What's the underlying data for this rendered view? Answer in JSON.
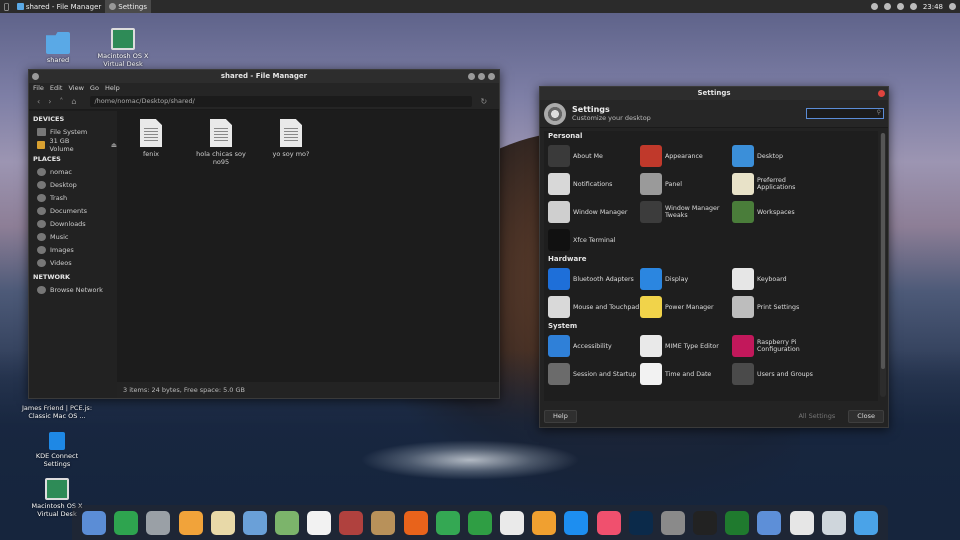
{
  "topbar": {
    "tasks": [
      {
        "label": "shared - File Manager",
        "icon": "folder-icon",
        "active": false
      },
      {
        "label": "Settings",
        "icon": "gear-icon",
        "active": true
      }
    ],
    "clock": "23:48"
  },
  "desktop_icons": [
    {
      "label": "shared",
      "icon": "folder-icon",
      "color": "#5aa9e6"
    },
    {
      "label": "Macintosh OS X Virtual Desk",
      "icon": "app-icon",
      "color": "#2e8b57"
    },
    {
      "label": "James Friend | PCE.js: Classic Mac OS ...",
      "icon": "web-icon",
      "color": "#888888"
    },
    {
      "label": "KDE Connect Settings",
      "icon": "kde-connect-icon",
      "color": "#1e88e5"
    },
    {
      "label": "Macintosh OS X Virtual Desk",
      "icon": "app-icon",
      "color": "#2e8b57"
    }
  ],
  "file_manager": {
    "title": "shared - File Manager",
    "menu": [
      "File",
      "Edit",
      "View",
      "Go",
      "Help"
    ],
    "path": "/home/nomac/Desktop/shared/",
    "devices_header": "DEVICES",
    "devices": [
      "File System",
      "31 GB Volume"
    ],
    "places_header": "PLACES",
    "places": [
      "nomac",
      "Desktop",
      "Trash",
      "Documents",
      "Downloads",
      "Music",
      "Images",
      "Videos"
    ],
    "network_header": "NETWORK",
    "network": [
      "Browse Network"
    ],
    "files": [
      "fenix",
      "hola chicas soy no95",
      "yo soy mo?"
    ],
    "status": "3 items: 24 bytes, Free space: 5.0 GB"
  },
  "settings": {
    "title": "Settings",
    "header_title": "Settings",
    "header_subtitle": "Customize your desktop",
    "sections": [
      {
        "name": "Personal",
        "items": [
          {
            "label": "About Me",
            "icon": "about-me-icon",
            "color": "#3a3a3a"
          },
          {
            "label": "Appearance",
            "icon": "appearance-icon",
            "color": "#c0392b"
          },
          {
            "label": "Desktop",
            "icon": "desktop-icon",
            "color": "#3b8fd9"
          },
          {
            "label": "Notifications",
            "icon": "notifications-icon",
            "color": "#d8d8d8"
          },
          {
            "label": "Panel",
            "icon": "panel-icon",
            "color": "#9a9a9a"
          },
          {
            "label": "Preferred Applications",
            "icon": "preferred-apps-icon",
            "color": "#e8e2c8"
          },
          {
            "label": "Window Manager",
            "icon": "window-manager-icon",
            "color": "#cfcfcf"
          },
          {
            "label": "Window Manager Tweaks",
            "icon": "wm-tweaks-icon",
            "color": "#3c3c3c"
          },
          {
            "label": "Workspaces",
            "icon": "workspaces-icon",
            "color": "#4a7d3a"
          },
          {
            "label": "Xfce Terminal",
            "icon": "terminal-icon",
            "color": "#111111"
          }
        ]
      },
      {
        "name": "Hardware",
        "items": [
          {
            "label": "Bluetooth Adapters",
            "icon": "bluetooth-icon",
            "color": "#1e6fd9"
          },
          {
            "label": "Display",
            "icon": "display-icon",
            "color": "#2b86e0"
          },
          {
            "label": "Keyboard",
            "icon": "keyboard-icon",
            "color": "#e6e6e6"
          },
          {
            "label": "Mouse and Touchpad",
            "icon": "mouse-icon",
            "color": "#d9d9d9"
          },
          {
            "label": "Power Manager",
            "icon": "power-bulb-icon",
            "color": "#f1d34a"
          },
          {
            "label": "Print Settings",
            "icon": "printer-icon",
            "color": "#bdbdbd"
          }
        ]
      },
      {
        "name": "System",
        "items": [
          {
            "label": "Accessibility",
            "icon": "accessibility-icon",
            "color": "#2f80d8"
          },
          {
            "label": "MIME Type Editor",
            "icon": "mime-editor-icon",
            "color": "#e9e9e9"
          },
          {
            "label": "Raspberry Pi Configuration",
            "icon": "raspberry-icon",
            "color": "#c2185b"
          },
          {
            "label": "Session and Startup",
            "icon": "session-icon",
            "color": "#6b6b6b"
          },
          {
            "label": "Time and Date",
            "icon": "clock-icon",
            "color": "#f2f2f2"
          },
          {
            "label": "Users and Groups",
            "icon": "users-icon",
            "color": "#4a4a4a"
          }
        ]
      }
    ],
    "help": "Help",
    "all_settings": "All Settings",
    "close": "Close"
  },
  "dock": [
    {
      "icon": "finder-icon",
      "color": "#5b8dd6"
    },
    {
      "icon": "spotify-like-icon",
      "color": "#2ea44f"
    },
    {
      "icon": "launchpad-icon",
      "color": "#9aa0a6"
    },
    {
      "icon": "photos-icon",
      "color": "#f1a33a"
    },
    {
      "icon": "notes-icon",
      "color": "#e8d9a8"
    },
    {
      "icon": "preview-icon",
      "color": "#6aa0d8"
    },
    {
      "icon": "maps-icon",
      "color": "#7cb46b"
    },
    {
      "icon": "calendar-icon",
      "color": "#f2f2f2"
    },
    {
      "icon": "dictionary-icon",
      "color": "#b0413e"
    },
    {
      "icon": "contacts-icon",
      "color": "#b8915a"
    },
    {
      "icon": "firefox-icon",
      "color": "#e8631b"
    },
    {
      "icon": "chrome-icon",
      "color": "#34a853"
    },
    {
      "icon": "numbers-icon",
      "color": "#2f9e44"
    },
    {
      "icon": "textedit-icon",
      "color": "#eaeaea"
    },
    {
      "icon": "pages-icon",
      "color": "#f0a030"
    },
    {
      "icon": "app-store-icon",
      "color": "#1d8ef0"
    },
    {
      "icon": "music-icon",
      "color": "#f0506e"
    },
    {
      "icon": "photoshop-icon",
      "color": "#0b2a4a"
    },
    {
      "icon": "system-preferences-icon",
      "color": "#8a8a8a"
    },
    {
      "icon": "terminal-icon",
      "color": "#222222"
    },
    {
      "icon": "radar-icon",
      "color": "#1f7a2e"
    },
    {
      "icon": "window-icon",
      "color": "#5d8fd8"
    },
    {
      "icon": "clock-icon",
      "color": "#e6e6e6"
    },
    {
      "icon": "trash-icon",
      "color": "#cfd6dc"
    },
    {
      "icon": "finder-icon",
      "color": "#4aa3e8"
    }
  ]
}
